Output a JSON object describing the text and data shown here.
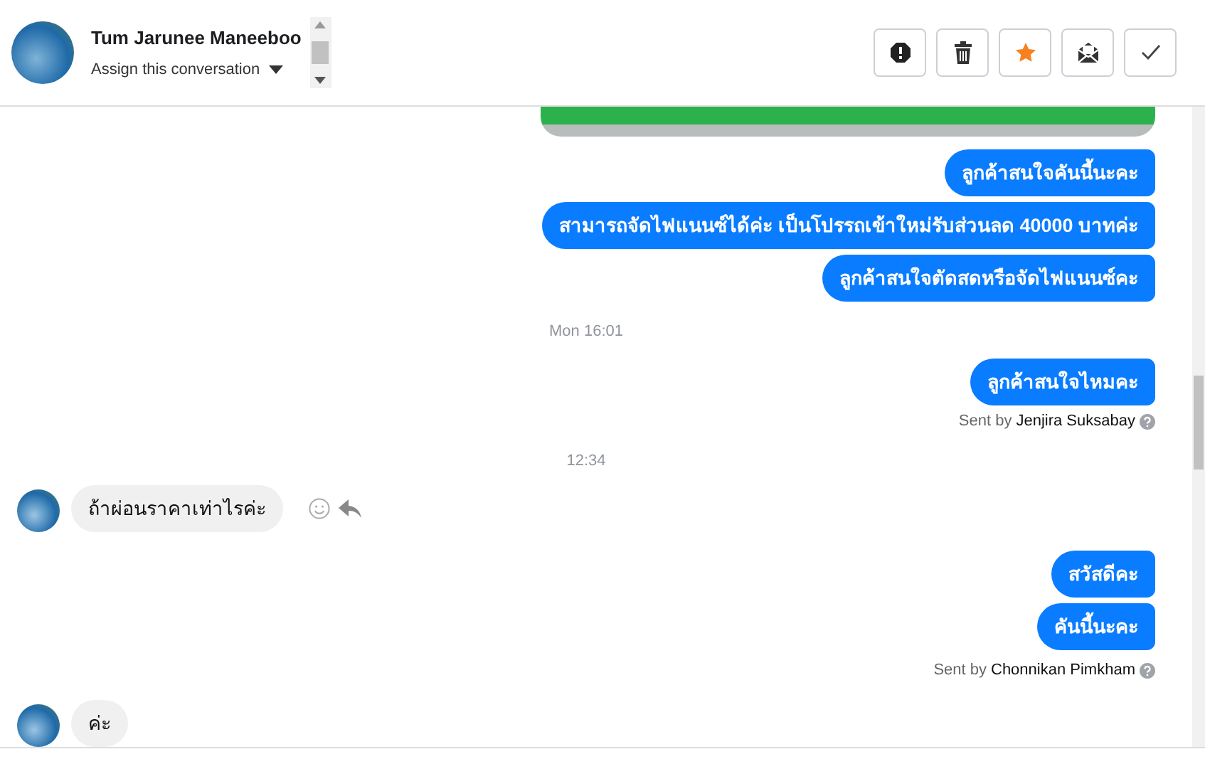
{
  "header": {
    "contact_name": "Tum Jarunee Maneeboo",
    "assign_label": "Assign this conversation"
  },
  "toolbar": [
    {
      "kind": "alert"
    },
    {
      "kind": "delete"
    },
    {
      "kind": "star"
    },
    {
      "kind": "mail"
    },
    {
      "kind": "done"
    }
  ],
  "messages": [
    {
      "kind": "image"
    },
    {
      "kind": "outgoing",
      "text": "ลูกค้าสนใจคันนี้นะคะ"
    },
    {
      "kind": "outgoing",
      "text": "สามารถจัดไฟแนนซ์ได้ค่ะ เป็นโปรรถเข้าใหม่รับส่วนลด 40000 บาทค่ะ"
    },
    {
      "kind": "outgoing",
      "text": "ลูกค้าสนใจตัดสดหรือจัดไฟแนนซ์คะ"
    },
    {
      "kind": "time",
      "text": "Mon 16:01"
    },
    {
      "kind": "outgoing",
      "text": "ลูกค้าสนใจไหมคะ"
    },
    {
      "kind": "sent_by",
      "prefix": "Sent by",
      "name": "Jenjira Suksabay"
    },
    {
      "kind": "time",
      "text": "12:34"
    },
    {
      "kind": "incoming",
      "text": "ถ้าผ่อนราคาเท่าไรค่ะ",
      "show_actions": true
    },
    {
      "kind": "outgoing",
      "text": "สวัสดีคะ"
    },
    {
      "kind": "outgoing",
      "text": "คันนี้นะคะ"
    },
    {
      "kind": "sent_by",
      "prefix": "Sent by",
      "name": "Chonnikan Pimkham"
    },
    {
      "kind": "incoming",
      "text": "ค่ะ",
      "show_actions": false
    }
  ]
}
